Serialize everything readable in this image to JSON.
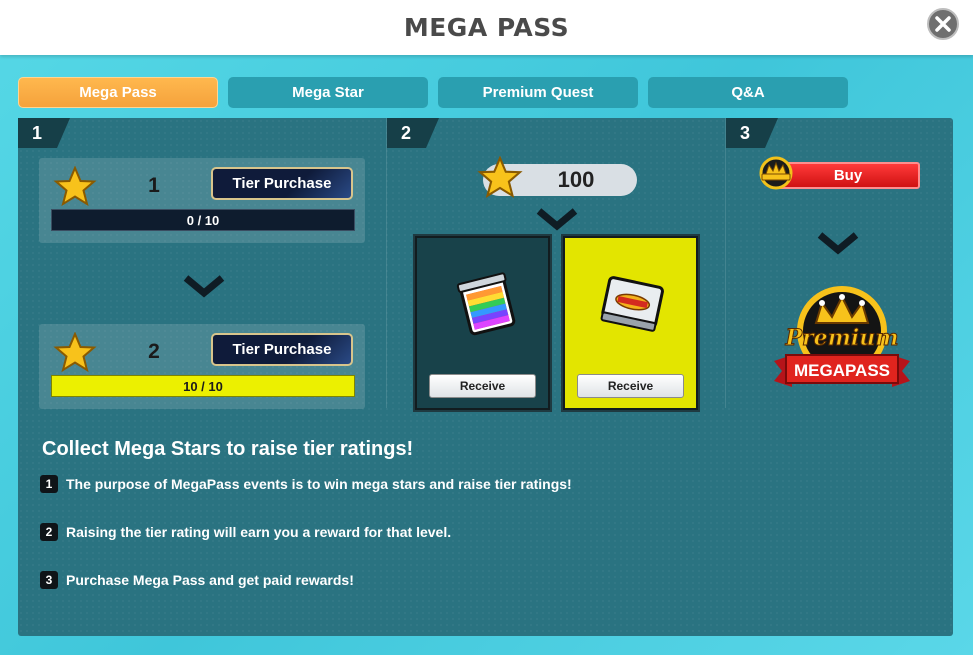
{
  "header": {
    "title": "MEGA PASS"
  },
  "tabs": [
    {
      "label": "Mega Pass",
      "active": true
    },
    {
      "label": "Mega Star",
      "active": false
    },
    {
      "label": "Premium Quest",
      "active": false
    },
    {
      "label": "Q&A",
      "active": false
    }
  ],
  "step1": {
    "number": "1",
    "tiers": [
      {
        "tier": "1",
        "button": "Tier Purchase",
        "progress_text": "0 / 10",
        "progress": 0.0
      },
      {
        "tier": "2",
        "button": "Tier Purchase",
        "progress_text": "10 / 10",
        "progress": 1.0
      }
    ]
  },
  "step2": {
    "number": "2",
    "star_count": "100",
    "rewards": [
      {
        "kind": "free",
        "button": "Receive",
        "icon": "rainbow-tile-pack-icon"
      },
      {
        "kind": "paid",
        "button": "Receive",
        "icon": "premium-tile-pack-icon"
      }
    ]
  },
  "step3": {
    "number": "3",
    "buy_label": "Buy",
    "badge_text": "Premium",
    "logo_top": "Premium",
    "logo_banner": "MEGAPASS"
  },
  "info": {
    "title": "Collect Mega Stars to raise tier ratings!",
    "items": [
      {
        "num": "1",
        "text": "The purpose of MegaPass events is to win mega stars and raise tier ratings!"
      },
      {
        "num": "2",
        "text": "Raising the tier rating will earn you a reward for that level."
      },
      {
        "num": "3",
        "text": "Purchase Mega Pass and get paid rewards!"
      }
    ]
  },
  "colors": {
    "accent_tab": "#f5a23c",
    "panel": "#2a7381",
    "paid_reward_bg": "#e3e500",
    "buy_red": "#e11b1b"
  }
}
